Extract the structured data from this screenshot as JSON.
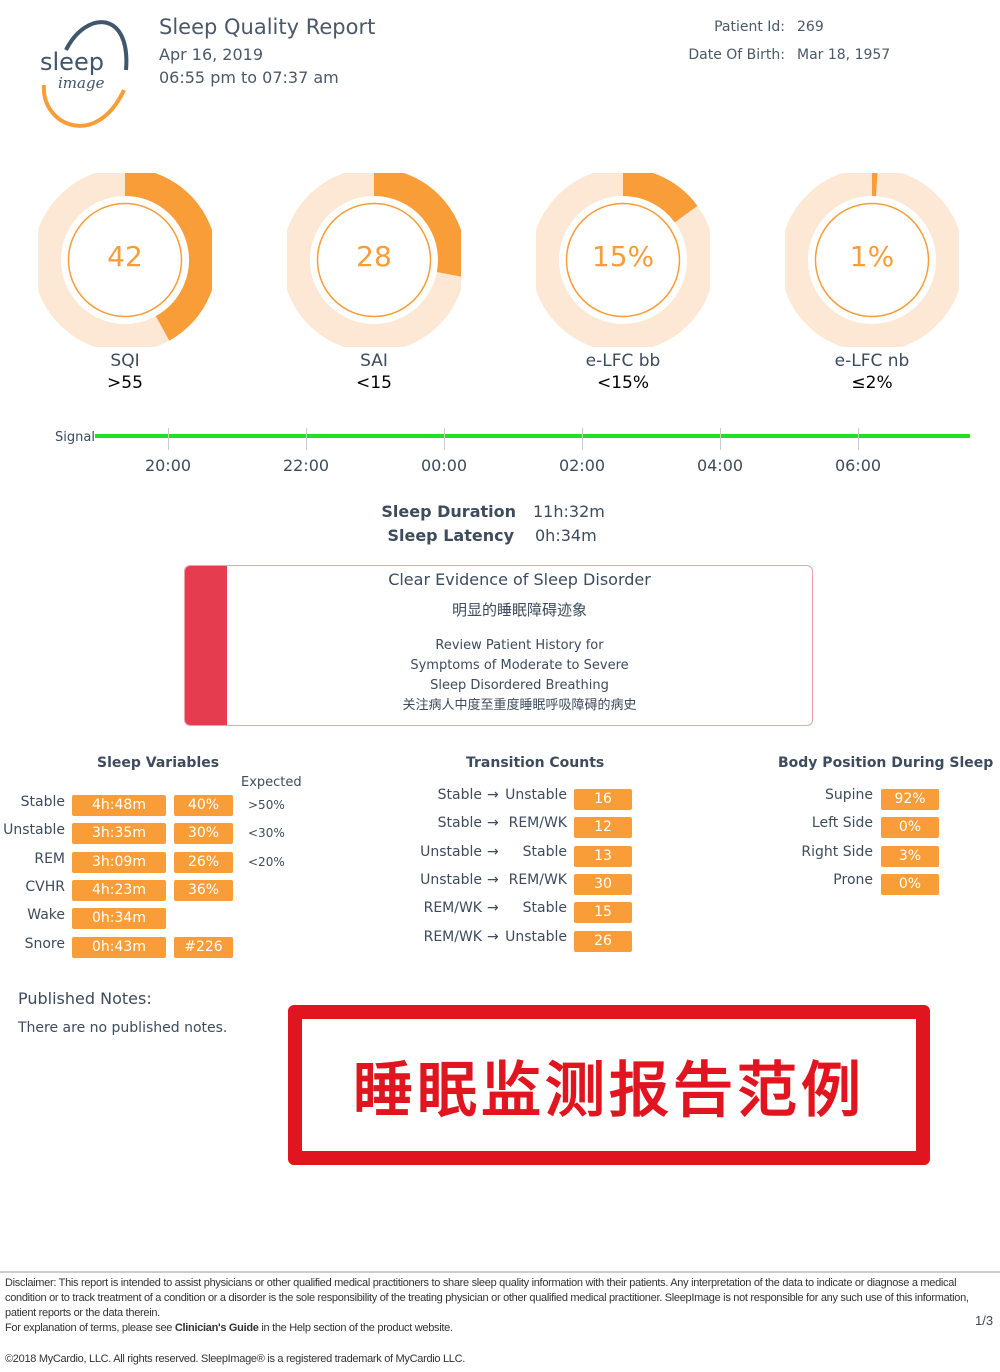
{
  "logo": {
    "text_top": "sleep",
    "text_bottom": "image"
  },
  "header": {
    "title": "Sleep Quality Report",
    "date": "Apr 16, 2019",
    "time_range": "06:55 pm to 07:37 am",
    "patient_id_label": "Patient Id:",
    "patient_id": "269",
    "dob_label": "Date Of Birth:",
    "dob": "Mar 18, 1957"
  },
  "gauges": [
    {
      "value": "42",
      "fraction": 0.42,
      "name": "SQI",
      "target": ">55"
    },
    {
      "value": "28",
      "fraction": 0.28,
      "name": "SAI",
      "target": "<15"
    },
    {
      "value": "15%",
      "fraction": 0.15,
      "name": "e-LFC bb",
      "target": "<15%"
    },
    {
      "value": "1%",
      "fraction": 0.01,
      "name": "e-LFC nb",
      "target": "≤2%"
    }
  ],
  "colors": {
    "accent": "#f99d38",
    "ring_bg": "#fde8d5",
    "signal": "#22e022",
    "alert": "#e53c50"
  },
  "signal": {
    "label": "Signal",
    "ticks": [
      "20:00",
      "22:00",
      "00:00",
      "02:00",
      "04:00",
      "06:00"
    ]
  },
  "duration": {
    "label": "Sleep Duration",
    "value": "11h:32m",
    "latency_label": "Sleep Latency",
    "latency": "0h:34m"
  },
  "alert": {
    "title": "Clear Evidence of Sleep Disorder",
    "title_cn": "明显的睡眠障碍迹象",
    "lines": [
      "Review Patient History for",
      "Symptoms of Moderate to Severe",
      "Sleep Disordered Breathing"
    ],
    "line_cn": "关注病人中度至重度睡眠呼吸障碍的病史"
  },
  "sleep_variables": {
    "title": "Sleep Variables",
    "expected_label": "Expected",
    "rows": [
      {
        "label": "Stable",
        "time": "4h:48m",
        "pct": "40%",
        "expected": ">50%"
      },
      {
        "label": "Unstable",
        "time": "3h:35m",
        "pct": "30%",
        "expected": "<30%"
      },
      {
        "label": "REM",
        "time": "3h:09m",
        "pct": "26%",
        "expected": "<20%"
      },
      {
        "label": "CVHR",
        "time": "4h:23m",
        "pct": "36%",
        "expected": ""
      },
      {
        "label": "Wake",
        "time": "0h:34m",
        "pct": "",
        "expected": ""
      },
      {
        "label": "Snore",
        "time": "0h:43m",
        "pct": "#226",
        "expected": ""
      }
    ]
  },
  "transitions": {
    "title": "Transition Counts",
    "rows": [
      {
        "from": "Stable",
        "to": "Unstable",
        "count": "16"
      },
      {
        "from": "Stable",
        "to": "REM/WK",
        "count": "12"
      },
      {
        "from": "Unstable",
        "to": "Stable",
        "count": "13"
      },
      {
        "from": "Unstable",
        "to": "REM/WK",
        "count": "30"
      },
      {
        "from": "REM/WK",
        "to": "Stable",
        "count": "15"
      },
      {
        "from": "REM/WK",
        "to": "Unstable",
        "count": "26"
      }
    ]
  },
  "body_position": {
    "title": "Body Position During Sleep",
    "rows": [
      {
        "label": "Supine",
        "pct": "92%"
      },
      {
        "label": "Left Side",
        "pct": "0%"
      },
      {
        "label": "Right Side",
        "pct": "3%"
      },
      {
        "label": "Prone",
        "pct": "0%"
      }
    ]
  },
  "notes": {
    "title": "Published Notes:",
    "text": "There are no published notes."
  },
  "stamp": {
    "text": "睡眠监测报告范例"
  },
  "footer": {
    "disclaimer": "Disclaimer: This report is intended to assist physicians or other qualified medical practitioners to share sleep quality information with their patients. Any interpretation of the data to indicate or diagnose a medical condition or to track treatment of a condition or a disorder is the sole responsibility of the treating physician or other qualified medical practitioner.  SleepImage is not responsible for any such use of this information, patient reports or the data therein.",
    "explain_pre": "For explanation of terms, please see ",
    "explain_bold": "Clinician's Guide",
    "explain_post": " in the Help section of the product website.",
    "page": "1/3",
    "copyright": "©2018 MyCardio, LLC. All rights reserved. SleepImage® is a registered trademark of MyCardio LLC."
  }
}
